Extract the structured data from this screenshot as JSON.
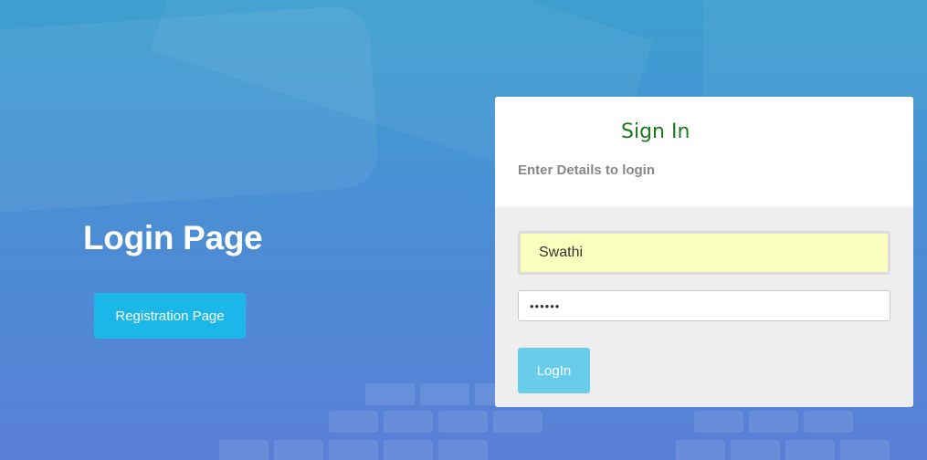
{
  "hero": {
    "title": "Login Page",
    "registration_label": "Registration Page"
  },
  "signin": {
    "title": "Sign In",
    "subtitle": "Enter Details to login",
    "username_value": "Swathi",
    "password_value": "••••••",
    "login_label": "LogIn"
  },
  "colors": {
    "registration_button": "#1bb7e8",
    "login_button": "#68cdea",
    "title_green": "#1a7a1a",
    "autofill_yellow": "#fbffbd"
  }
}
